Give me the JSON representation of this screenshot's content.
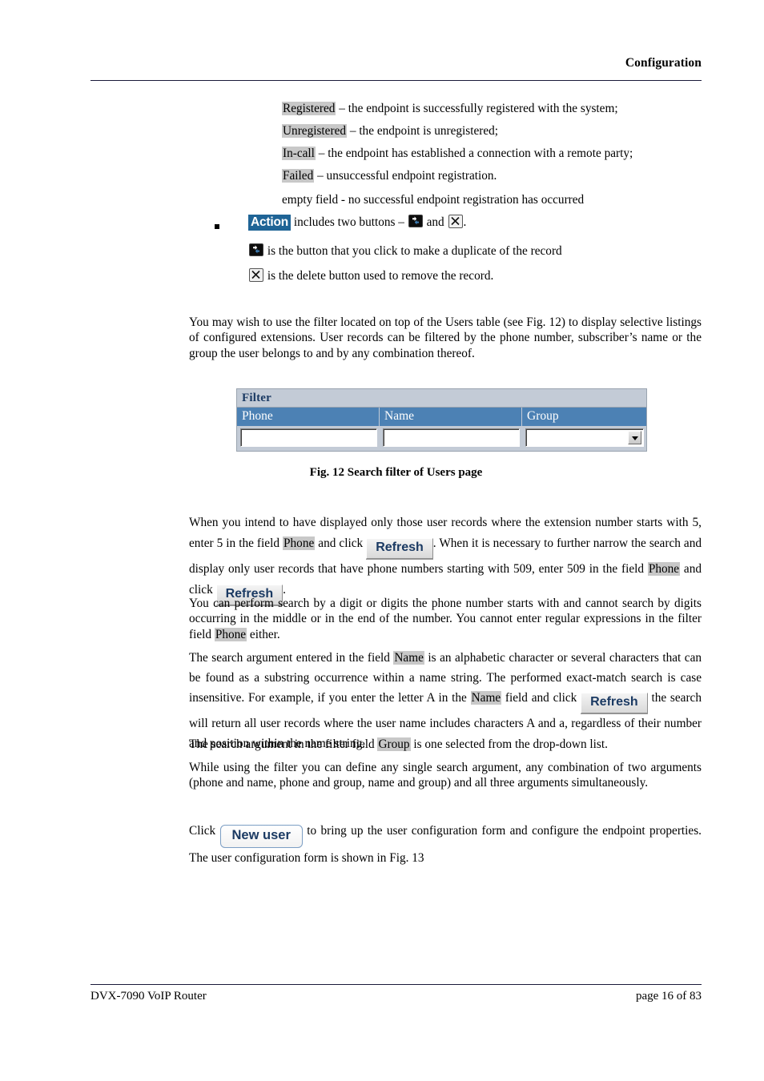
{
  "header": {
    "title": "Configuration"
  },
  "footer": {
    "left": "DVX-7090 VoIP Router",
    "right": "page 16 of 83"
  },
  "status_list": [
    {
      "term": "Registered",
      "rest": " – the endpoint is successfully registered with the system;"
    },
    {
      "term": "Unregistered",
      "rest": " – the endpoint is unregistered;"
    },
    {
      "term": "In-call",
      "rest": " – the endpoint has established a connection with a remote party;"
    },
    {
      "term": "Failed",
      "rest": " – unsuccessful endpoint registration."
    }
  ],
  "empty_field_line": "empty field -  no successful endpoint registration has occurred",
  "action_item": {
    "label": "Action",
    "text_before": "includes two buttons – ",
    "text_middle": " and ",
    "text_after": ".",
    "duplicate_icon": "duplicate-icon",
    "delete_icon": "delete-x-icon"
  },
  "duplicate_line": "is the button that you click to make a duplicate of the record",
  "delete_line": "is the delete button used to remove the record.",
  "paragraph_filter_intro": "You may wish to use the filter located on top of the Users table (see Fig. 12) to display selective listings of configured extensions. User records can be filtered by the phone number, subscriber’s name or the group the user belongs to and by any combination thereof.",
  "filter_figure": {
    "title": "Filter",
    "columns": [
      "Phone",
      "Name",
      "Group"
    ],
    "phone_value": "",
    "name_value": "",
    "group_value": "",
    "dropdown_icon": "chevron-down-icon",
    "caption": "Fig. 12 Search filter of Users page"
  },
  "paragraph_refresh": {
    "p1": "When you intend to have displayed only those user records where the extension number starts with 5, enter 5 in the field ",
    "field_phone": "Phone",
    "p2": " and click ",
    "refresh_label": "Refresh",
    "p3": ". When it is necessary to further narrow the search and display only user records that have phone numbers starting with 509, enter 509 in the field ",
    "p4": " and click ",
    "p5": "."
  },
  "paragraph_digits": {
    "p1": "You can perform search by a digit or digits the phone number starts with and cannot search by digits occurring in the middle or in the end of the number. You cannot enter regular expressions in the filter field ",
    "field_phone": "Phone",
    "p2": " either."
  },
  "paragraph_name": {
    "p1": "The search argument entered in the field ",
    "field_name": "Name",
    "p2": " is an alphabetic character or several characters that can be found as a substring occurrence within a name string. The performed exact-match search is case insensitive. For example, if you enter the letter A in the ",
    "p3": " field and click ",
    "refresh_label": "Refresh",
    "p4": " the search will return all user records where the user name includes characters A and a, regardless of their number and position within the name string."
  },
  "paragraph_group": {
    "p1": "The search argument in the filter field ",
    "field_group": "Group",
    "p2": " is one selected from the drop-down list."
  },
  "paragraph_combination": "While using the filter you can define any single search argument, any combination of two arguments (phone and name, phone and group, name and group) and all three arguments simultaneously.",
  "paragraph_newuser": {
    "p1": "Click ",
    "button_label": "New user",
    "p2": " to bring up the user configuration form and configure the endpoint properties. The user configuration form is shown in Fig. 13"
  },
  "colors": {
    "accent_blue": "#4c81b4",
    "header_bar": "#c3cbd6",
    "action_badge": "#1f6496",
    "highlight_gray": "#c8c8c8",
    "button_text": "#1b3a63"
  }
}
